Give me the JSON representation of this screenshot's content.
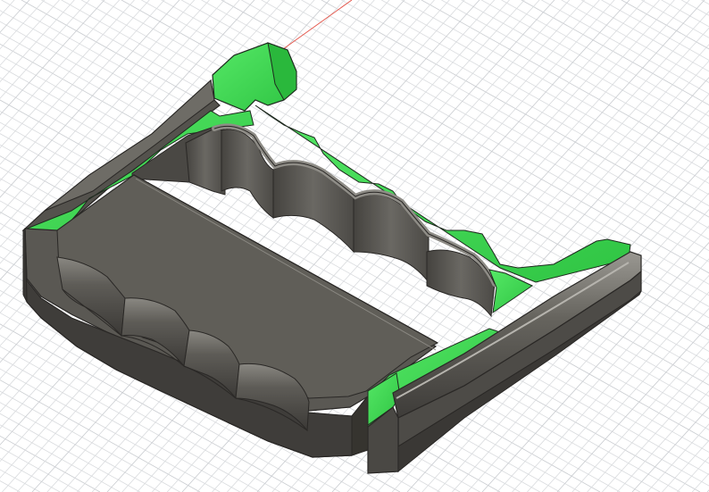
{
  "viewport": {
    "background": "#ffffff",
    "grid_color": "#d9dbde",
    "grid_major_color": "#c9ccd0",
    "origin_axis_color": "#e4574c"
  },
  "model": {
    "body_color": "#5c5a55",
    "body_dark": "#45433f",
    "body_light": "#7a7872",
    "body_top": "#66645e",
    "highlight_color": "#3fdc52",
    "highlight_dark": "#1f9a2f",
    "edge_color": "#2a2826"
  }
}
